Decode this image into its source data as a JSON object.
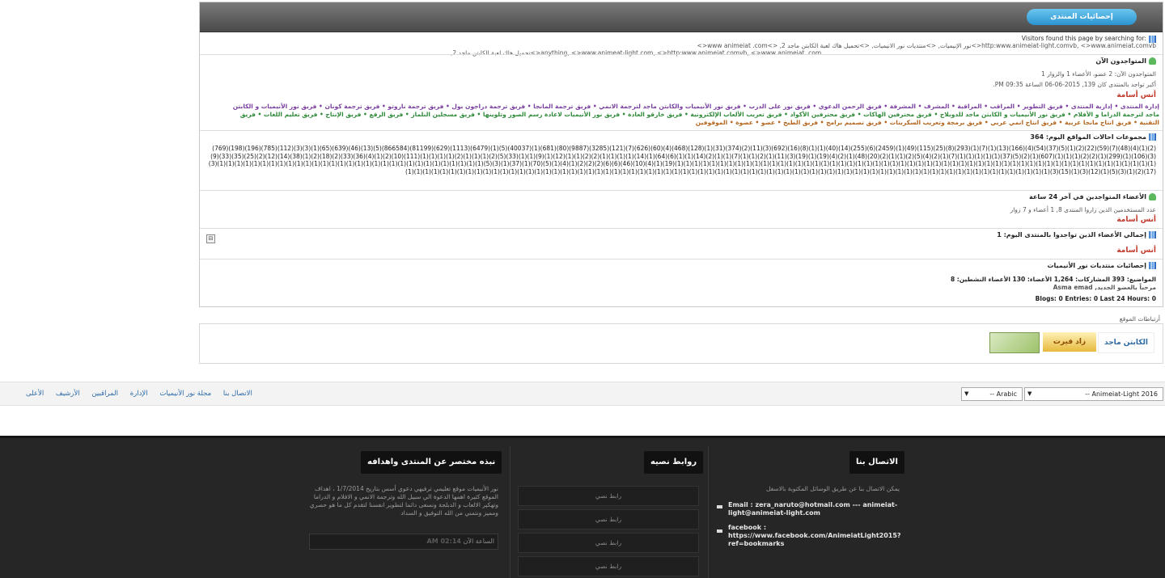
{
  "stats": {
    "title": "إحصائيات المنتدى",
    "search_label": "Visitors found this page by searching for:",
    "search_line1": "http:www.animeiat-light.comvb, <>www.animeiat.comvb<>نور الإنيميات, <>منتديات نور الانيميات, <>تحميل هاك لعبة الكابتن ماجد 2, <>www animeiat .com<>",
    "search_line2": "anything, <>www.animeat-light.com, <>http:www.animeiat.comvb, <>www animeiat .com<>تحميل هاك لعبة الكابتن ماجد 2,",
    "online_title": "المتواجدون الآن",
    "online_summary": "المتواجدون الآن: 2 عضو، الأعضاء 1 والزوار 1",
    "online_record": "أكبر تواجد بالمنتدى كان 139, 2015-06-06 الساعة 09:35 PM.",
    "online_user": "أنس أسامة",
    "teams_line1": "إدارة المنتدى • إدارية المنتدى • فريق التطوير • المراقب • المراقبة • المشرف • المشرفة • فريق الرحمن الدعوي • فريق نور على الدرب • فريق نور الأنيميات والكابتن ماجد لترجمة الانمي • فريق ترجمة المانجا • فريق ترجمة دراجون بول • فريق ترجمة ناروتو • فريق ترجمة كونان • فريق نور الأنيميات و الكابتن",
    "teams_line2": "ماجد لترجمة الدراما و الأفلام • فريق نور الأنيميات و الكابتن ماجد للدوبلاج • فريق محترفين الهاكات • فريق محترفين الأكواد • فريق تعريب الألعاب الإلكترونية • فريق خارقو العادة • فريق نور الأنيميات لاعادة رسم الصور وتلوينها • فريق مسجلين النلماز • فريق الرفع • فريق الإنتاج • فريق تعليم اللغات • فريق",
    "teams_line3": "التقنية • فريق انتاج مانجا عربية • فريق انتاج انمي عربي • فريق برمجة وتعريب السكربتات • فريق تصميم برامج • فريق الطبخ • عضو • عضوة • الموقوفين",
    "referrals_title": "مجموعات احالات المواقع اليوم: 364",
    "referral_counts": "(769)(198)(196)(785)(112)(3)(3)(1)(65)(639)(46)(13)(5)(866584)(81199)(629)(1113)(6479)(1)(5)(40037)(1)(681)(80)(9887)(3285)(121)(7)(626)(60)(4)(468)(128)(1)(31)(374)(2)(11)(3)(692)(16)(8)(1)(1)(40)(14)(255)(6)(2459)(1)(49)(115)(25)(8)(293)(1)(7)(1)(13)(166)(4)(54)(37)(5)(1)(2)(22)(59)(7)(48)(4)(1)(2)(9)(33)(35)(25)(2)(12)(14)(38)(1)(2)(18)(2)(33)(36)(4)(1)(2)(10)(111)(1)(1)(1)(1)(2)(1)(1)(1)(2)(5)(33)(1)(1)(9)(1)(12)(1)(1)(2)(2)(1)(1)(1)(1)(14)(1)(64)(6)(1)(1)(14)(2)(1)(1)(7)(1)(1)(2)(1)(11)(3)(19)(1)(19)(4)(2)(1)(48)(20)(2)(1)(1)(2)(5)(4)(2)(1)(7)(1)(1)(1)(1)(1)(37)(5)(2)(1)(607)(1)(1)(1)(2)(2)(1)(299)(1)(106)(3)(3)(1)(1)(1)(1)(1)(1)(1)(1)(1)(1)(1)(1)(1)(1)(1)(1)(1)(1)(1)(1)(1)(1)(1)(1)(1)(1)(1)(1)(1)(1)(1)(5)(3)(1)(37)(1)(70)(5)(1)(4)(1)(2)(2)(2)(6)(6)(46)(10)(4)(1)(19)(1)(1)(1)(1)(1)(1)(1)(1)(1)(1)(1)(1)(1)(1)(1)(1)(1)(1)(1)(1)(1)(1)(1)(1)(1)(1)(1)(1)(1)(1)(1)(1)(1)(1)(1)(1)(1)(1)(1)(1)(1)(1)(1)(1)(1)(1)(1)(1)(1)(1)(1)(1)(1)(1)(1)(1)(1)(1)(1)(1)(1)(1)(1)(1)(1)(1)(1)(1)(1)(1)(1)(1)(1)(1)(1)(1)(1)(1)(1)(1)(1)(1)(1)(1)(1)(1)(1)(1)(1)(1)(1)(1)(1)(1)(1)(1)(1)(1)(1)(1)(1)(1)(1)(1)(1)(1)(1)(1)(1)(1)(1)(1)(1)(1)(1)(1)(1)(1)(1)(1)(1)(1)(1)(1)(1)(1)(1)(1)(1)(1)(1)(3)(15)(1)(3)(12)(1)(5)(3)(1)(2)(17)",
    "last24_title": "الأعضاء المتواجدين في آخر 24 ساعة",
    "last24_summary": "عدد المستخدمين الذين زاروا المنتدى 8, 1 أعضاء و 7 زوار",
    "last24_user": "أنس أسامة",
    "today_title": "إجمالي الأعضاء الذين تواجدوا بالمنتدى اليوم: 1",
    "today_user": "أنس أسامة",
    "forum_stats_title": "إحصائيات منتديات نور الأنيميات",
    "forum_stats_line": "المواضيع: 393  المشاركات: 1,264  الأعضاء: 130  الأعضاء النشطين: 8",
    "welcome_line": "مرحباً بالعضو الجديد, Asma emad",
    "blogs_line": "Blogs: 0 Entries: 0 Last 24 Hours: 0",
    "collapse_symbol": "⊟"
  },
  "links": {
    "label": "أرتباطات الموقع",
    "banner_text_1": "الكابتن ماجد",
    "banner_text_2": "زاد فيرت"
  },
  "navbar": {
    "items": [
      "الاتصال بنا",
      "مجلة نور الأنيميات",
      "الإدارة",
      "المراقبين",
      "الأرشيف",
      "الأعلى"
    ],
    "style_select": "-- Animeiat-Light 2016",
    "lang_select": "-- Arabic"
  },
  "footer": {
    "contact": {
      "title": "الاتصال بنا",
      "subtitle": "يمكن الاتصال بنا عن طريق الوسائل المكتوبة بالاسفل",
      "email": "Email : zera_naruto@hotmail.com --- animeiat-light@animeiat-light.com",
      "facebook": "facebook : https://www.facebook.com/AnimeiatLight2015?ref=bookmarks"
    },
    "text_links": {
      "title": "روابط نصيه",
      "items": [
        "رابط نصي",
        "رابط نصي",
        "رابط نصي",
        "رابط نصي"
      ]
    },
    "about": {
      "title": "نبذه مختصر عن المنتدى واهدافه",
      "body": "نور الأنيميات موقع تعليمي ترفيهي دعوي أسس بتاريخ 1/7/2014 ، اهداف الموقع كثيرة اهمها الدعوة الي سبيل الله وترجمة الانمي و الافلام و الدراما وتهكير الالعاب و الدبلجة ونسعى دائما لتطوير انفسنا لتقدم كل ما هو حصري ومميز ونتمني من الله التوفيق و السداد",
      "time_label": "الساعة الآن",
      "time_value": "02:14 AM"
    }
  }
}
